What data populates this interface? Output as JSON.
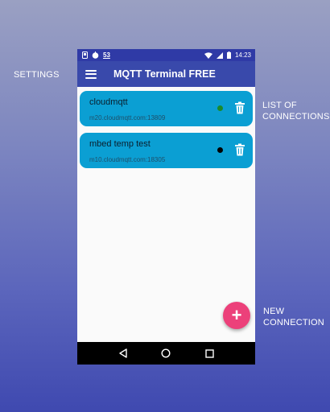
{
  "callouts": {
    "settings": "SETTINGS",
    "list_line1": "LIST OF",
    "list_line2": "CONNECTIONS",
    "new_line1": "NEW",
    "new_line2": "CONNECTION"
  },
  "status_bar": {
    "time": "14:23",
    "notification_text": "53",
    "icons": [
      "sim-icon",
      "android-icon",
      "notification-icon",
      "wifi-icon",
      "signal-icon",
      "battery-icon"
    ]
  },
  "app_bar": {
    "title": "MQTT Terminal FREE"
  },
  "connections": [
    {
      "name": "cloudmqtt",
      "host": "m20.cloudmqtt.com:13809",
      "status_color": "#1b8a2a"
    },
    {
      "name": "mbed temp test",
      "host": "m10.cloudmqtt.com:18305",
      "status_color": "#000000"
    }
  ],
  "fab": {
    "symbol": "+"
  },
  "colors": {
    "status_bar": "#2f3aa6",
    "app_bar": "#3949ab",
    "card": "#0b9fd3",
    "fab": "#ec407a"
  }
}
